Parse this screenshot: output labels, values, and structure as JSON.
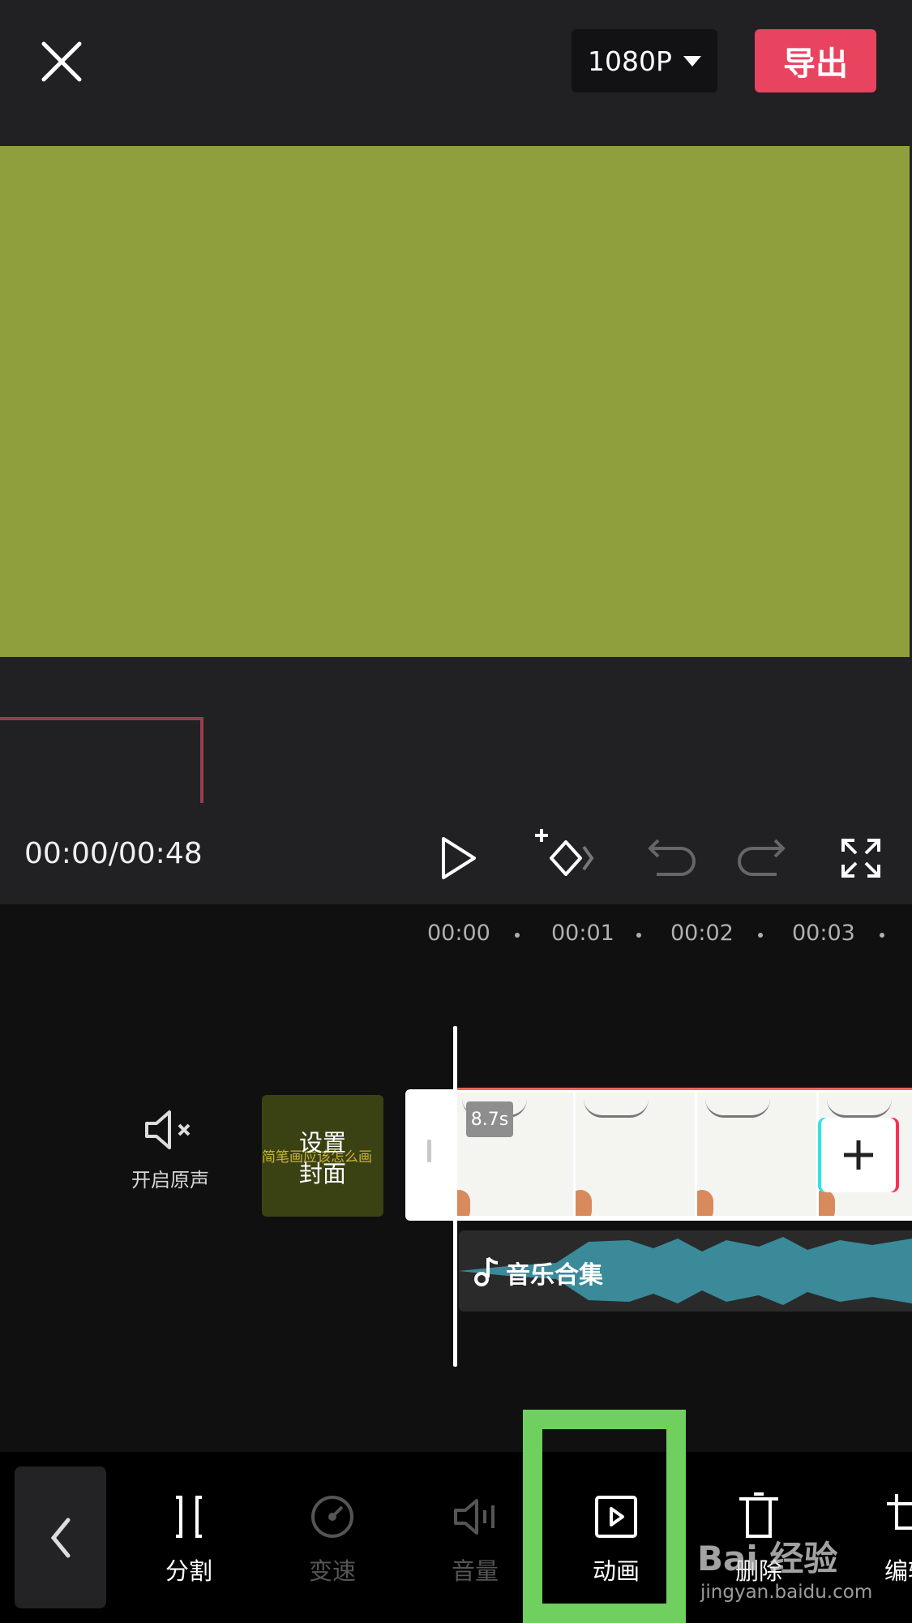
{
  "header": {
    "resolution": "1080P",
    "export_label": "导出"
  },
  "controls": {
    "timecode": "00:00/00:48"
  },
  "timeline": {
    "ruler": [
      "00:00",
      "00:01",
      "00:02",
      "00:03"
    ],
    "mute_label": "开启原声",
    "cover_label_line1": "设置",
    "cover_label_line2": "封面",
    "cover_bg_text": "简笔画应该怎么画",
    "clip_duration": "8.7s",
    "audio_label": "音乐合集"
  },
  "toolbar": {
    "items": [
      {
        "label": "分割",
        "icon": "split-icon",
        "enabled": true
      },
      {
        "label": "变速",
        "icon": "speed-icon",
        "enabled": false
      },
      {
        "label": "音量",
        "icon": "volume-icon",
        "enabled": false
      },
      {
        "label": "动画",
        "icon": "animation-icon",
        "enabled": true
      },
      {
        "label": "删除",
        "icon": "delete-icon",
        "enabled": true
      },
      {
        "label": "编辑",
        "icon": "edit-icon",
        "enabled": true
      }
    ]
  },
  "watermark": {
    "brand": "Bai 经验",
    "url": "jingyan.baidu.com"
  },
  "colors": {
    "canvas": "#8f9f3d",
    "export": "#e8435f",
    "highlight": "#6fcf5f",
    "waveform": "#3a8a99"
  }
}
